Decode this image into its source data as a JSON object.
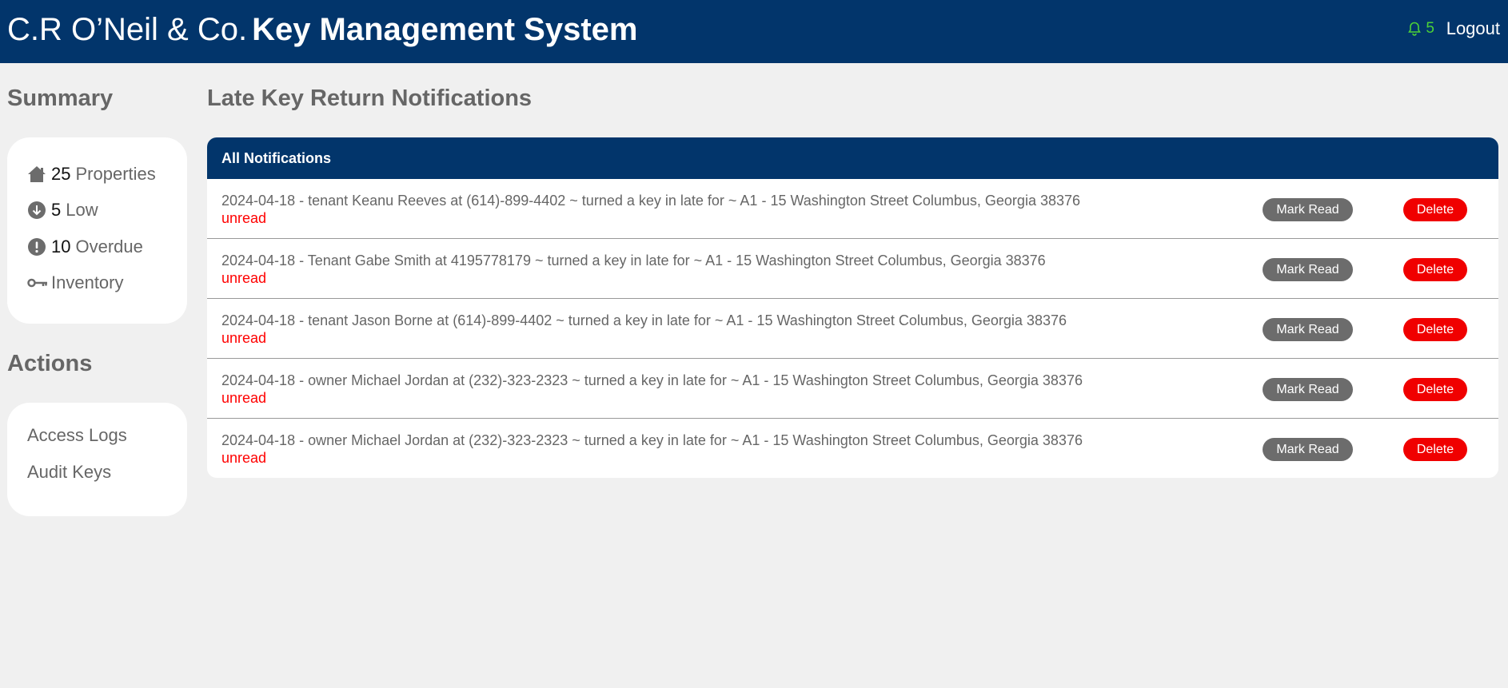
{
  "header": {
    "company": "C.R O’Neil & Co.",
    "system": "Key Management System",
    "notification_count": "5",
    "logout_label": "Logout"
  },
  "sidebar": {
    "summary_title": "Summary",
    "summary_items": [
      {
        "icon": "house-icon",
        "count": "25",
        "label": "Properties"
      },
      {
        "icon": "arrow-down-circle-icon",
        "count": "5",
        "label": "Low"
      },
      {
        "icon": "exclamation-circle-icon",
        "count": "10",
        "label": "Overdue"
      },
      {
        "icon": "key-icon",
        "count": "",
        "label": "Inventory"
      }
    ],
    "actions_title": "Actions",
    "action_items": [
      {
        "label": "Access Logs"
      },
      {
        "label": "Audit Keys"
      }
    ]
  },
  "main": {
    "page_title": "Late Key Return Notifications",
    "panel_title": "All Notifications",
    "mark_read_label": "Mark Read",
    "delete_label": "Delete",
    "notifications": [
      {
        "message": "2024-04-18 - tenant Keanu Reeves at (614)-899-4402 ~ turned a key in late for ~ A1 - 15 Washington Street Columbus, Georgia 38376",
        "status": "unread"
      },
      {
        "message": "2024-04-18 - Tenant Gabe Smith at 4195778179 ~ turned a key in late for ~ A1 - 15 Washington Street Columbus, Georgia 38376",
        "status": "unread"
      },
      {
        "message": "2024-04-18 - tenant Jason Borne at (614)-899-4402 ~ turned a key in late for ~ A1 - 15 Washington Street Columbus, Georgia 38376",
        "status": "unread"
      },
      {
        "message": "2024-04-18 - owner Michael Jordan at (232)-323-2323 ~ turned a key in late for ~ A1 - 15 Washington Street Columbus, Georgia 38376",
        "status": "unread"
      },
      {
        "message": "2024-04-18 - owner Michael Jordan at (232)-323-2323 ~ turned a key in late for ~ A1 - 15 Washington Street Columbus, Georgia 38376",
        "status": "unread"
      }
    ]
  },
  "colors": {
    "header_bg": "#02356b",
    "notification_accent": "#4cd137",
    "unread": "#ff0000",
    "mark_read_bg": "#6c6c6c",
    "delete_bg": "#f00000"
  }
}
